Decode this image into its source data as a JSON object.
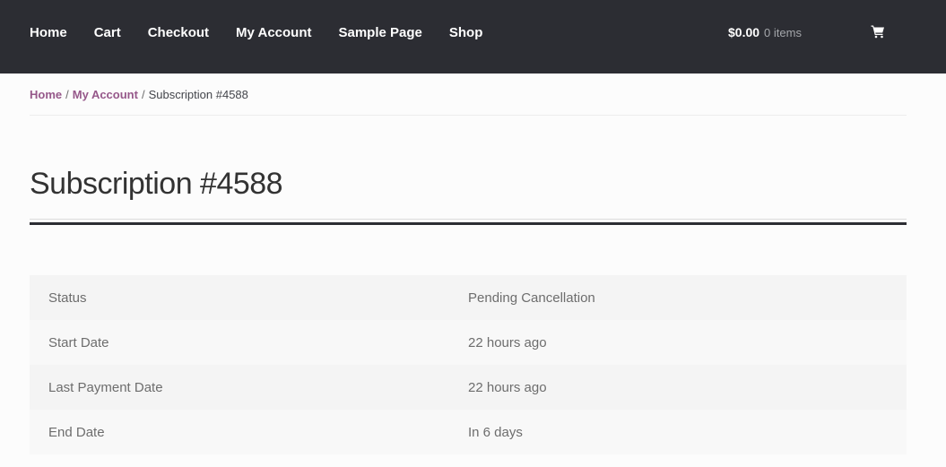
{
  "nav": {
    "items": [
      "Home",
      "Cart",
      "Checkout",
      "My Account",
      "Sample Page",
      "Shop"
    ]
  },
  "cart": {
    "amount": "$0.00",
    "count": "0 items",
    "icon": "cart-icon"
  },
  "breadcrumb": {
    "home": "Home",
    "account": "My Account",
    "separator": "/",
    "current": "Subscription #4588"
  },
  "page": {
    "title": "Subscription #4588"
  },
  "details": {
    "rows": [
      {
        "label": "Status",
        "value": "Pending Cancellation"
      },
      {
        "label": "Start Date",
        "value": "22 hours ago"
      },
      {
        "label": "Last Payment Date",
        "value": "22 hours ago"
      },
      {
        "label": "End Date",
        "value": "In 6 days"
      }
    ]
  },
  "colors": {
    "header_bg": "#2c2d33",
    "link_accent": "#96588a"
  }
}
